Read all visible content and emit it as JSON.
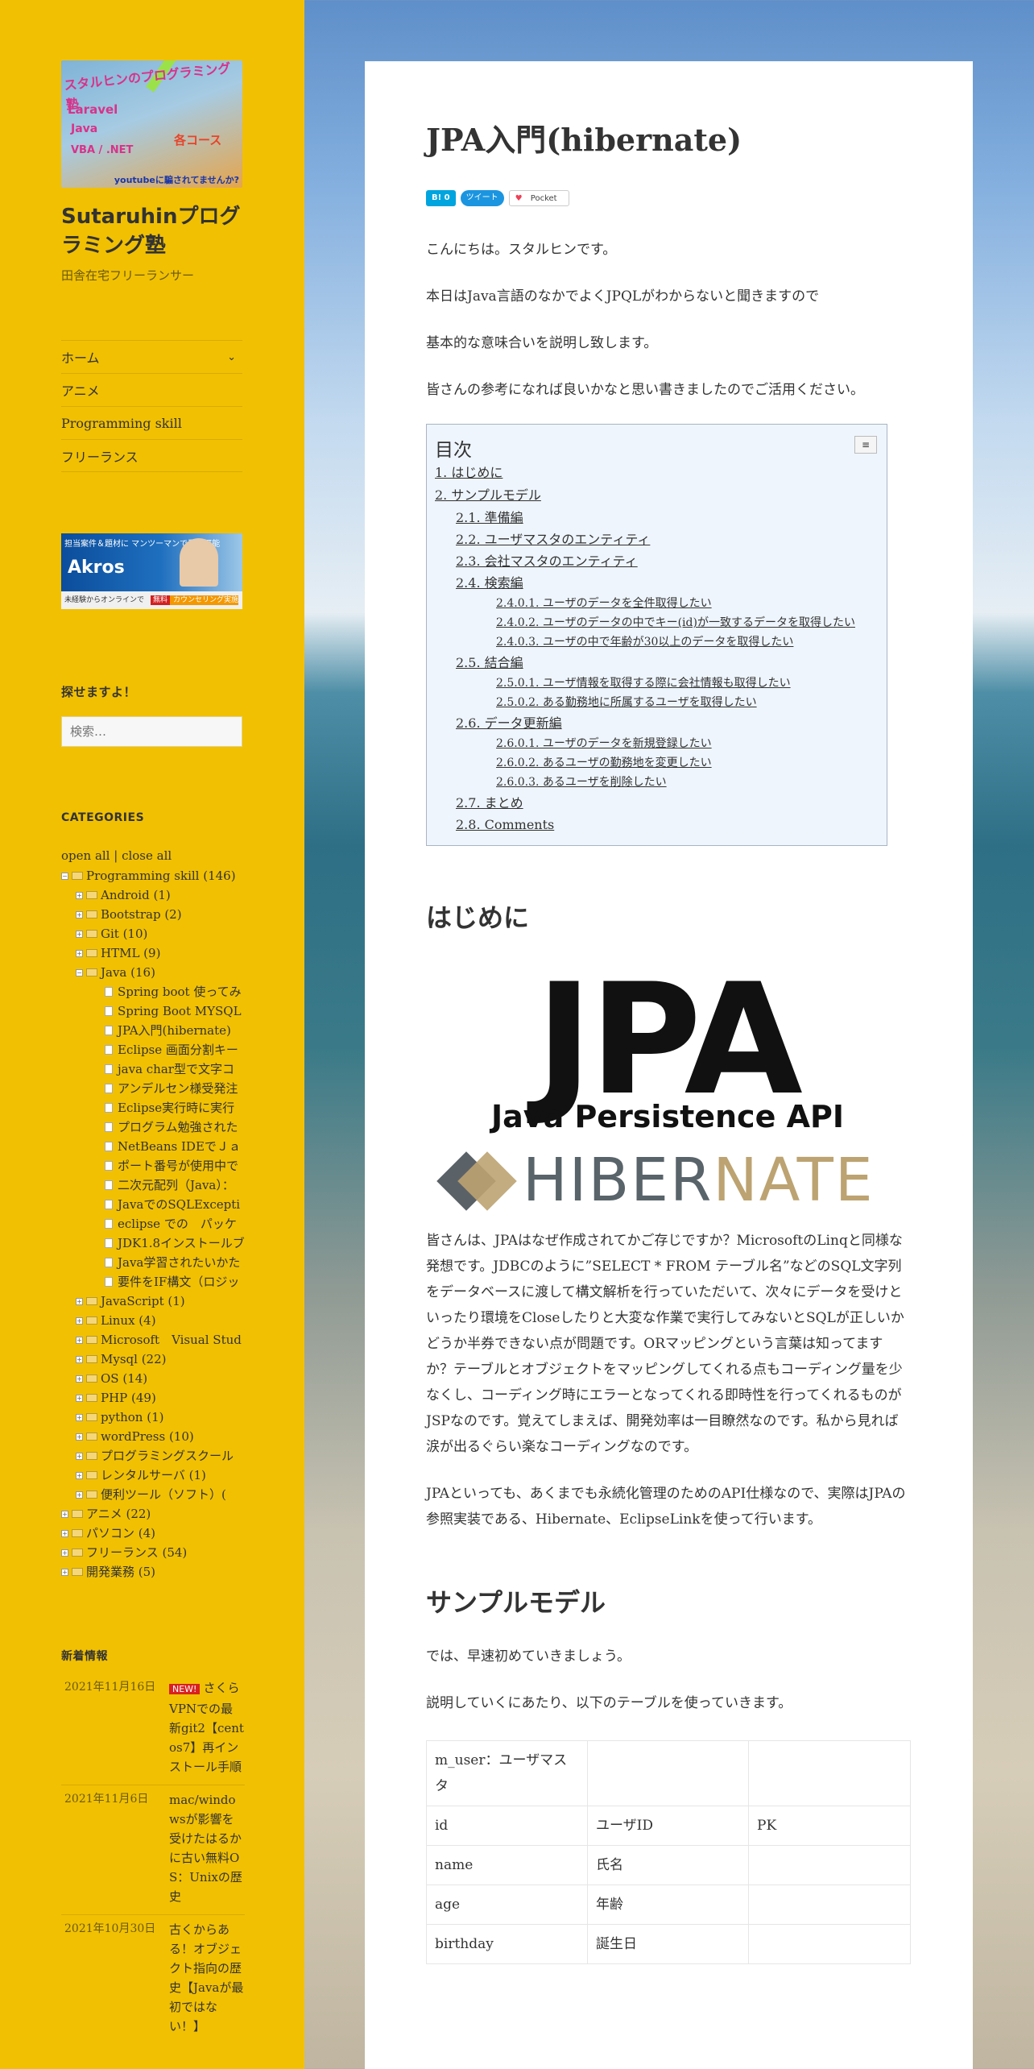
{
  "site": {
    "logo": {
      "line1": "スタルヒンのプログラミング塾",
      "line2": "Laravel",
      "line3": "Java",
      "line4": "VBA / .NET",
      "line5": "各コース",
      "line6": "youtubeに騙されてませんか?"
    },
    "title": "Sutaruhinプログラミング塾",
    "description": "田舎在宅フリーランサー"
  },
  "nav": {
    "items": [
      {
        "label": "ホーム",
        "has_submenu": true
      },
      {
        "label": "アニメ",
        "has_submenu": false
      },
      {
        "label": "Programming skill",
        "has_submenu": false
      },
      {
        "label": "フリーランス",
        "has_submenu": false
      }
    ],
    "chevron": "⌄"
  },
  "banner": {
    "line1": "担当案件＆題材に マンツーマンで受講可能",
    "brand": "Akros",
    "bottom": "未経験からオンラインで",
    "free": "無料",
    "counsel": "カウンセリング実施中"
  },
  "search": {
    "title": "探せますよ！",
    "placeholder": "検索…"
  },
  "categories": {
    "title": "CATEGORIES",
    "open_all": "open all",
    "separator": " | ",
    "close_all": "close all",
    "tree": [
      {
        "depth": 1,
        "type": "folder",
        "pm": "−",
        "label": "Programming skill (146)"
      },
      {
        "depth": 2,
        "type": "folder",
        "pm": "+",
        "label": "Android (1)"
      },
      {
        "depth": 2,
        "type": "folder",
        "pm": "+",
        "label": "Bootstrap (2)"
      },
      {
        "depth": 2,
        "type": "folder",
        "pm": "+",
        "label": "Git (10)"
      },
      {
        "depth": 2,
        "type": "folder",
        "pm": "+",
        "label": "HTML (9)"
      },
      {
        "depth": 2,
        "type": "folder",
        "pm": "−",
        "label": "Java (16)"
      },
      {
        "depth": 3,
        "type": "doc",
        "pm": "",
        "label": "Spring boot 使ってみ"
      },
      {
        "depth": 3,
        "type": "doc",
        "pm": "",
        "label": "Spring Boot MYSQL"
      },
      {
        "depth": 3,
        "type": "doc",
        "pm": "",
        "label": "JPA入門(hibernate)"
      },
      {
        "depth": 3,
        "type": "doc",
        "pm": "",
        "label": "Eclipse 画面分割キー"
      },
      {
        "depth": 3,
        "type": "doc",
        "pm": "",
        "label": "java char型で文字コ"
      },
      {
        "depth": 3,
        "type": "doc",
        "pm": "",
        "label": "アンデルセン様受発注"
      },
      {
        "depth": 3,
        "type": "doc",
        "pm": "",
        "label": "Eclipse実行時に実行"
      },
      {
        "depth": 3,
        "type": "doc",
        "pm": "",
        "label": "プログラム勉強された"
      },
      {
        "depth": 3,
        "type": "doc",
        "pm": "",
        "label": "NetBeans IDEでＪａ"
      },
      {
        "depth": 3,
        "type": "doc",
        "pm": "",
        "label": "ポート番号が使用中で"
      },
      {
        "depth": 3,
        "type": "doc",
        "pm": "",
        "label": "二次元配列（Java）："
      },
      {
        "depth": 3,
        "type": "doc",
        "pm": "",
        "label": "JavaでのSQLExcepti"
      },
      {
        "depth": 3,
        "type": "doc",
        "pm": "",
        "label": "eclipse での　パッケ"
      },
      {
        "depth": 3,
        "type": "doc",
        "pm": "",
        "label": "JDK1.8インストールブ"
      },
      {
        "depth": 3,
        "type": "doc",
        "pm": "",
        "label": "Java学習されたいかた"
      },
      {
        "depth": 3,
        "type": "doc",
        "pm": "",
        "label": "要件をIF構文（ロジッ"
      },
      {
        "depth": 2,
        "type": "folder",
        "pm": "+",
        "label": "JavaScript (1)"
      },
      {
        "depth": 2,
        "type": "folder",
        "pm": "+",
        "label": "Linux (4)"
      },
      {
        "depth": 2,
        "type": "folder",
        "pm": "+",
        "label": "Microsoft　Visual Stud"
      },
      {
        "depth": 2,
        "type": "folder",
        "pm": "+",
        "label": "Mysql (22)"
      },
      {
        "depth": 2,
        "type": "folder",
        "pm": "+",
        "label": "OS (14)"
      },
      {
        "depth": 2,
        "type": "folder",
        "pm": "+",
        "label": "PHP (49)"
      },
      {
        "depth": 2,
        "type": "folder",
        "pm": "+",
        "label": "python (1)"
      },
      {
        "depth": 2,
        "type": "folder",
        "pm": "+",
        "label": "wordPress (10)"
      },
      {
        "depth": 2,
        "type": "folder",
        "pm": "+",
        "label": "プログラミングスクール"
      },
      {
        "depth": 2,
        "type": "folder",
        "pm": "+",
        "label": "レンタルサーバ (1)"
      },
      {
        "depth": 2,
        "type": "folder",
        "pm": "+",
        "label": "便利ツール（ソフト）("
      },
      {
        "depth": 1,
        "type": "folder",
        "pm": "+",
        "label": "アニメ (22)"
      },
      {
        "depth": 1,
        "type": "folder",
        "pm": "+",
        "label": "パソコン (4)"
      },
      {
        "depth": 1,
        "type": "folder",
        "pm": "+",
        "label": "フリーランス (54)"
      },
      {
        "depth": 1,
        "type": "folder",
        "pm": "+",
        "label": "開発業務 (5)"
      }
    ]
  },
  "news": {
    "title": "新着情報",
    "new_badge": "NEW!",
    "items": [
      {
        "date": "2021年11月16日",
        "is_new": true,
        "text": "さくらVPNでの最新git2【centos7】再インストール手順"
      },
      {
        "date": "2021年11月6日",
        "is_new": false,
        "text": "mac/windowsが影響を受けたはるかに古い無料OS：Unixの歴史"
      },
      {
        "date": "2021年10月30日",
        "is_new": false,
        "text": "古くからある！オブジェクト指向の歴史【Javaが最初ではない！】"
      }
    ]
  },
  "post": {
    "title": "JPA入門(hibernate)",
    "share": {
      "hatena": "B! 0",
      "tweet": "ツイート",
      "pocket": "Pocket"
    },
    "intro": [
      "こんにちは。スタルヒンです。",
      "本日はJava言語のなかでよくJPQLがわからないと聞きますので",
      "基本的な意味合いを説明し致します。",
      "皆さんの参考になれば良いかなと思い書きましたのでご活用ください。"
    ],
    "toc": {
      "title": "目次",
      "toggle": "≡",
      "items": [
        {
          "level": 1,
          "label": "1. はじめに"
        },
        {
          "level": 1,
          "label": "2. サンプルモデル"
        },
        {
          "level": 2,
          "label": "2.1. 準備編"
        },
        {
          "level": 2,
          "label": "2.2. ユーザマスタのエンティティ"
        },
        {
          "level": 2,
          "label": "2.3. 会社マスタのエンティティ"
        },
        {
          "level": 2,
          "label": "2.4. 検索編"
        },
        {
          "level": 3,
          "label": "2.4.0.1.  ユーザのデータを全件取得したい"
        },
        {
          "level": 3,
          "label": "2.4.0.2.  ユーザのデータの中でキー(id)が一致するデータを取得したい"
        },
        {
          "level": 3,
          "label": "2.4.0.3.  ユーザの中で年齢が30以上のデータを取得したい"
        },
        {
          "level": 2,
          "label": "2.5. 結合編"
        },
        {
          "level": 3,
          "label": "2.5.0.1.  ユーザ情報を取得する際に会社情報も取得したい"
        },
        {
          "level": 3,
          "label": "2.5.0.2.  ある勤務地に所属するユーザを取得したい"
        },
        {
          "level": 2,
          "label": "2.6. データ更新編"
        },
        {
          "level": 3,
          "label": "2.6.0.1.  ユーザのデータを新規登録したい"
        },
        {
          "level": 3,
          "label": "2.6.0.2.  あるユーザの勤務地を変更したい"
        },
        {
          "level": 3,
          "label": "2.6.0.3.  あるユーザを削除したい"
        },
        {
          "level": 2,
          "label": "2.7. まとめ"
        },
        {
          "level": 2,
          "label": "2.8. Comments"
        }
      ]
    },
    "section1": {
      "heading": "はじめに",
      "image": {
        "big": "JPA",
        "sub": "Java Persistence API",
        "hib1": "HIBER",
        "hib2": "NATE"
      },
      "para1": "皆さんは、JPAはなぜ作成されてかご存じですか？MicrosoftのLinqと同様な発想です。JDBCのように”SELECT * FROM テーブル名”などのSQL文字列をデータベースに渡して構文解析を行っていただいて、次々にデータを受けといったり環境をCloseしたりと大変な作業で実行してみないとSQLが正しいかどうか半券できない点が問題です。ORマッピングという言葉は知ってますか？テーブルとオブジェクトをマッピングしてくれる点もコーディング量を少なくし、コーディング時にエラーとなってくれる即時性を行ってくれるものがJSPなのです。覚えてしまえば、開発効率は一目瞭然なのです。私から見れば涙が出るぐらい楽なコーディングなのです。",
      "para2": "JPAといっても、あくまでも永続化管理のためのAPI仕様なので、実際はJPAの参照実装である、Hibernate、EclipseLinkを使って行います。"
    },
    "section2": {
      "heading": "サンプルモデル",
      "para1": "では、早速初めていきましょう。",
      "para2": "説明していくにあたり、以下のテーブルを使っていきます。",
      "table": [
        [
          "m_user：ユーザマスタ",
          "",
          ""
        ],
        [
          "id",
          "ユーザID",
          "PK"
        ],
        [
          "name",
          "氏名",
          ""
        ],
        [
          "age",
          "年齢",
          ""
        ],
        [
          "birthday",
          "誕生日",
          ""
        ]
      ]
    }
  }
}
